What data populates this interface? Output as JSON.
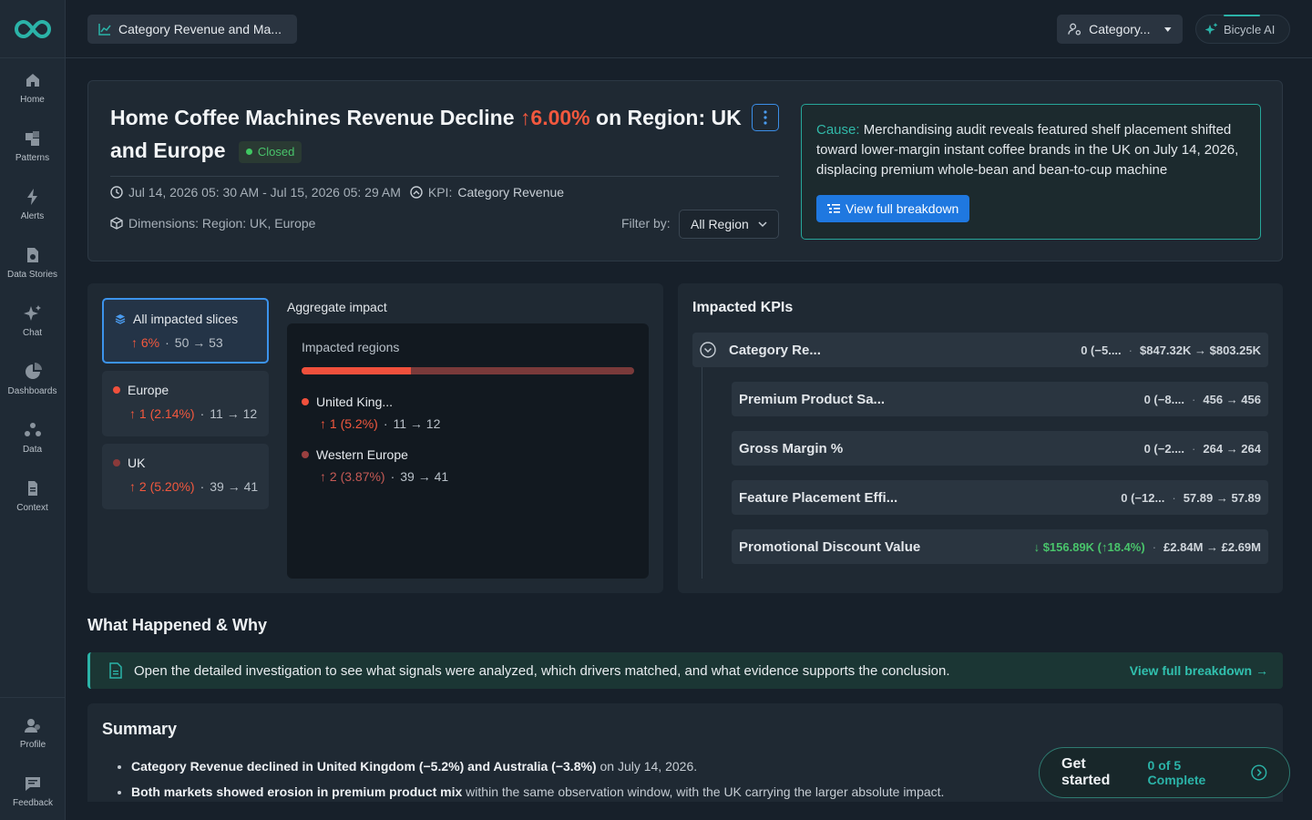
{
  "app": {
    "colors": {
      "accent": "#2bb3a8",
      "primary": "#1f78e0",
      "negative": "#f2583e",
      "positive": "#49c46b"
    }
  },
  "nav": {
    "items": [
      {
        "label": "Home",
        "icon": "home-icon"
      },
      {
        "label": "Patterns",
        "icon": "patterns-icon"
      },
      {
        "label": "Alerts",
        "icon": "bolt-icon"
      },
      {
        "label": "Data Stories",
        "icon": "document-icon"
      },
      {
        "label": "Chat",
        "icon": "sparkle-icon"
      },
      {
        "label": "Dashboards",
        "icon": "pie-icon"
      },
      {
        "label": "Data",
        "icon": "data-icon"
      },
      {
        "label": "Context",
        "icon": "file-icon"
      }
    ],
    "bottom": [
      {
        "label": "Profile",
        "icon": "profile-icon"
      },
      {
        "label": "Feedback",
        "icon": "feedback-icon"
      }
    ]
  },
  "topbar": {
    "breadcrumb": "Category Revenue and Ma...",
    "category_select": "Category...",
    "ai_button": "Bicycle AI"
  },
  "header": {
    "title_pre": "Home Coffee Machines Revenue Decline",
    "title_pct": "6.00%",
    "title_post": "on Region: UK and Europe",
    "status": "Closed",
    "time_range": "Jul 14, 2026 05: 30 AM - Jul 15, 2026 05: 29 AM",
    "kpi_label": "KPI:",
    "kpi_value": "Category Revenue",
    "dimensions": "Dimensions: Region: UK, Europe",
    "filter_label": "Filter by:",
    "filter_value": "All Region",
    "cause_label": "Cause:",
    "cause_text": "Merchandising audit reveals featured shelf placement shifted toward lower-margin instant coffee brands in the UK on July 14, 2026, displacing premium whole-bean and bean-to-cup machine",
    "cause_button": "View full breakdown"
  },
  "slices": [
    {
      "name": "All impacted slices",
      "change": "6%",
      "from_to": "50 → 53"
    },
    {
      "name": "Europe",
      "change": "1 (2.14%)",
      "from_to": "11 → 12"
    },
    {
      "name": "UK",
      "change": "2 (5.20%)",
      "from_to": "39 → 41"
    }
  ],
  "aggregate": {
    "title": "Aggregate impact",
    "subtitle": "Impacted regions",
    "bar_fraction": 0.33,
    "regions": [
      {
        "name": "United King...",
        "change": "1 (5.2%)",
        "from_to": "11 → 12",
        "color": "#f0503c"
      },
      {
        "name": "Western Europe",
        "change": "2 (3.87%)",
        "from_to": "39 → 41",
        "color": "#9a4040"
      }
    ]
  },
  "kpis": {
    "title": "Impacted KPIs",
    "rows": [
      {
        "name": "Category Re...",
        "change": "0 (−5....",
        "from_to": "$847.32K → $803.25K"
      },
      {
        "name": "Premium Product Sa...",
        "change": "0 (−8....",
        "from_to": "456 → 456"
      },
      {
        "name": "Gross Margin %",
        "change": "0 (−2....",
        "from_to": "264 → 264"
      },
      {
        "name": "Feature Placement Effi...",
        "change": "0 (−12...",
        "from_to": "57.89 → 57.89"
      },
      {
        "name": "Promotional Discount Value",
        "change": "$156.89K (↑18.4%)",
        "from_to": "£2.84M → £2.69M"
      }
    ]
  },
  "what_happened": {
    "title": "What Happened & Why",
    "banner_text": "Open the detailed investigation to see what signals were analyzed, which drivers matched, and what evidence supports the conclusion.",
    "banner_link": "View full breakdown →"
  },
  "summary": {
    "title": "Summary",
    "items": [
      {
        "bold": "Category Revenue declined in United Kingdom (−5.2%) and Australia (−3.8%)",
        "rest": " on July 14, 2026."
      },
      {
        "bold": "Both markets showed erosion in premium product mix",
        "rest": " within the same observation window, with the UK carrying the larger absolute impact."
      }
    ]
  },
  "get_started": {
    "label": "Get started",
    "progress": "0 of 5 Complete"
  }
}
